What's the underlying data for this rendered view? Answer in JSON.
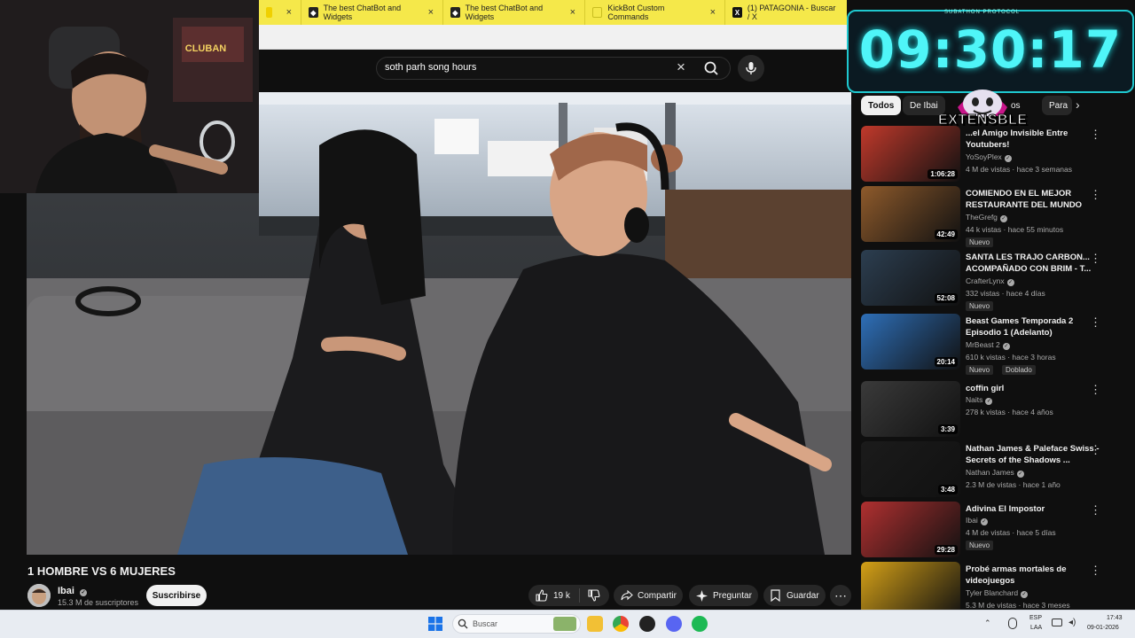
{
  "browser": {
    "tabs": [
      {
        "label": "",
        "favicon_color": "#f0d000"
      },
      {
        "label": "The best ChatBot and Widgets",
        "favicon_color": "#222222"
      },
      {
        "label": "The best ChatBot and Widgets",
        "favicon_color": "#222222"
      },
      {
        "label": "KickBot Custom Commands",
        "favicon_color": "#f5e84a"
      },
      {
        "label": "(1) PATAGONIA - Buscar / X",
        "favicon_color": "#111111"
      }
    ]
  },
  "youtube": {
    "search": {
      "value": "soth parh song hours"
    },
    "video": {
      "title": "1 HOMBRE VS 6 MUJERES",
      "channel": "Ibai",
      "subscribers": "15.3 M de suscriptores",
      "subscribe_label": "Suscribirse",
      "likes": "19 k",
      "share_label": "Compartir",
      "ask_label": "Preguntar",
      "save_label": "Guardar"
    },
    "chips": [
      "Todos",
      "De Ibai",
      "os",
      "Para"
    ],
    "recommendations": [
      {
        "title": "...el Amigo Invisible Entre Youtubers!",
        "channel": "YoSoyPlex",
        "meta": "4 M de vistas · hace 3 semanas",
        "duration": "1:06:28",
        "badges": [],
        "thumb": "#c0392b"
      },
      {
        "title": "COMIENDO EN EL MEJOR RESTAURANTE DEL MUNDO",
        "channel": "TheGrefg",
        "meta": "44 k vistas · hace 55 minutos",
        "duration": "42:49",
        "badges": [
          "Nuevo"
        ],
        "thumb": "#8e5a2b"
      },
      {
        "title": "SANTA LES TRAJO CARBON... ACOMPAÑADO CON BRIM - T...",
        "channel": "CrafterLynx",
        "meta": "332 vistas · hace 4 días",
        "duration": "52:08",
        "badges": [
          "Nuevo"
        ],
        "thumb": "#2c3e50"
      },
      {
        "title": "Beast Games Temporada 2 Episodio 1 (Adelanto)",
        "channel": "MrBeast 2",
        "meta": "610 k vistas · hace 3 horas",
        "duration": "20:14",
        "badges": [
          "Nuevo",
          "Doblado"
        ],
        "thumb": "#2e6fb8"
      },
      {
        "title": "coffin girl",
        "channel": "Naits",
        "meta": "278 k vistas · hace 4 años",
        "duration": "3:39",
        "badges": [],
        "thumb": "#3a3a3a"
      },
      {
        "title": "Nathan James & Paleface Swiss - Secrets of the Shadows ...",
        "channel": "Nathan James",
        "meta": "2.3 M de vistas · hace 1 año",
        "duration": "3:48",
        "badges": [],
        "thumb": "#1b1b1b"
      },
      {
        "title": "Adivina El Impostor",
        "channel": "Ibai",
        "meta": "4 M de vistas · hace 5 días",
        "duration": "29:28",
        "badges": [
          "Nuevo"
        ],
        "thumb": "#b03030"
      },
      {
        "title": "Probé armas mortales de videojuegos",
        "channel": "Tyler Blanchard",
        "meta": "5.3 M de vistas · hace 3 meses",
        "duration": "",
        "badges": [],
        "thumb": "#d4a017"
      }
    ]
  },
  "overlay": {
    "timer_header": "SUBATHON PROTOCOL",
    "timer": "09:30:17",
    "extensible": "EXTENSBLE",
    "accent_color": "#4ff5f8"
  },
  "taskbar": {
    "search_placeholder": "Buscar",
    "lang_1": "ESP",
    "lang_2": "LAA",
    "time": "17:43",
    "date": "09-01-2026"
  }
}
